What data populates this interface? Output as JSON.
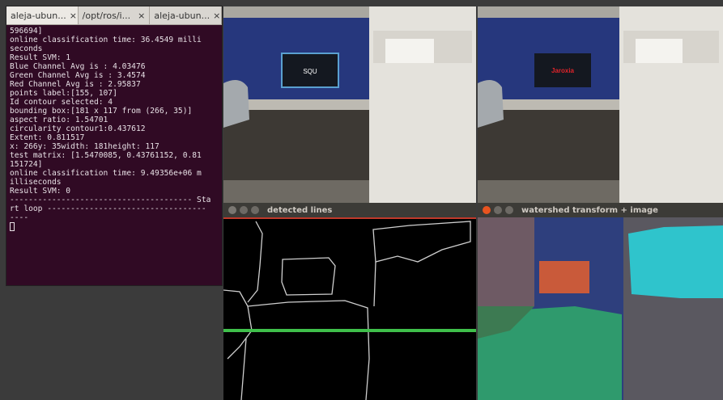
{
  "terminal": {
    "tabs": [
      {
        "label": "aleja-ubun...",
        "close": "×"
      },
      {
        "label": "/opt/ros/i...",
        "close": "×"
      },
      {
        "label": "aleja-ubun...",
        "close": "×"
      }
    ],
    "lines": [
      "596694]",
      "online classification time: 36.4549 milli",
      "seconds",
      "",
      "Result SVM: 1",
      "Blue Channel Avg is : 4.03476",
      "Green Channel Avg is : 3.4574",
      "Red Channel Avg is : 2.95837",
      "points label:[155, 107]",
      "Id contour selected: 4",
      "bounding box:[181 x 117 from (266, 35)]",
      "aspect ratio: 1.54701",
      "circularity contour1:0.437612",
      "Extent: 0.811517",
      "x: 266y: 35width: 181height: 117",
      "test matrix: [1.5470085, 0.43761152, 0.81",
      "151724]",
      "online classification time: 9.49356e+06 m",
      "illiseconds",
      "",
      "Result SVM: 0",
      "--------------------------------------- Sta",
      "rt loop ----------------------------------",
      "----"
    ]
  },
  "cam1": {
    "monitor_label": "SQU"
  },
  "cam2": {
    "monitor_label": "Jaroxia"
  },
  "lines_window": {
    "title": "detected lines"
  },
  "watershed_window": {
    "title": "watershed transform + image"
  },
  "colors": {
    "terminal_bg": "#300a24",
    "wall_blue": "#24357c",
    "green_line": "#3fbf4b",
    "red_line": "#c0392b",
    "close_btn": "#e95420"
  },
  "icons": {
    "close": "close-icon",
    "minimize": "minimize-icon",
    "maximize": "maximize-icon"
  }
}
